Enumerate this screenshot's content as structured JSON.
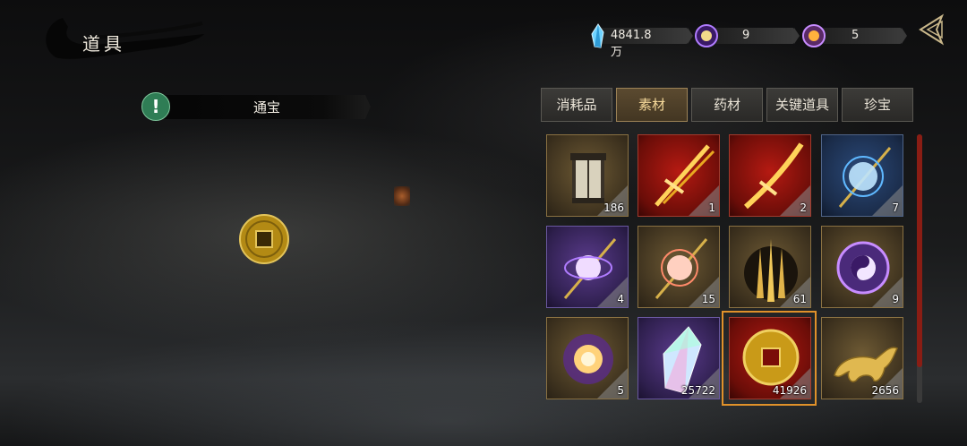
{
  "header": {
    "title": "道具"
  },
  "currencies": [
    {
      "icon": "spirit-crystal-icon",
      "value": "4841.8万",
      "color": "#4fc3ff"
    },
    {
      "icon": "purple-orb-icon",
      "value": "9",
      "color": "#a765ff"
    },
    {
      "icon": "gold-orb-icon",
      "value": "5",
      "color": "#ffb13d"
    }
  ],
  "selected_item": {
    "name": "通宝",
    "alert_icon": "!"
  },
  "tabs": [
    {
      "label": "消耗品",
      "active": false
    },
    {
      "label": "素材",
      "active": true
    },
    {
      "label": "药材",
      "active": false
    },
    {
      "label": "关键道具",
      "active": false
    },
    {
      "label": "珍宝",
      "active": false
    }
  ],
  "items": [
    {
      "icon": "lantern-icon",
      "rarity": "gold",
      "qty": "186"
    },
    {
      "icon": "golden-sword-icon",
      "rarity": "red",
      "qty": "1"
    },
    {
      "icon": "golden-blade-icon",
      "rarity": "red",
      "qty": "2"
    },
    {
      "icon": "blue-orb-staff-icon",
      "rarity": "blue",
      "qty": "7"
    },
    {
      "icon": "purple-orb-staff-icon",
      "rarity": "purple",
      "qty": "4"
    },
    {
      "icon": "pink-orb-staff-icon",
      "rarity": "gold",
      "qty": "15"
    },
    {
      "icon": "golden-spears-icon",
      "rarity": "gold",
      "qty": "61"
    },
    {
      "icon": "yin-yang-orb-icon",
      "rarity": "gold",
      "qty": "9"
    },
    {
      "icon": "glowing-orb-icon",
      "rarity": "gold",
      "qty": "5"
    },
    {
      "icon": "crystal-shard-icon",
      "rarity": "purple",
      "qty": "25722"
    },
    {
      "icon": "copper-coin-icon",
      "rarity": "red",
      "qty": "41926"
    },
    {
      "icon": "golden-beast-icon",
      "rarity": "gold",
      "qty": "2656"
    }
  ]
}
